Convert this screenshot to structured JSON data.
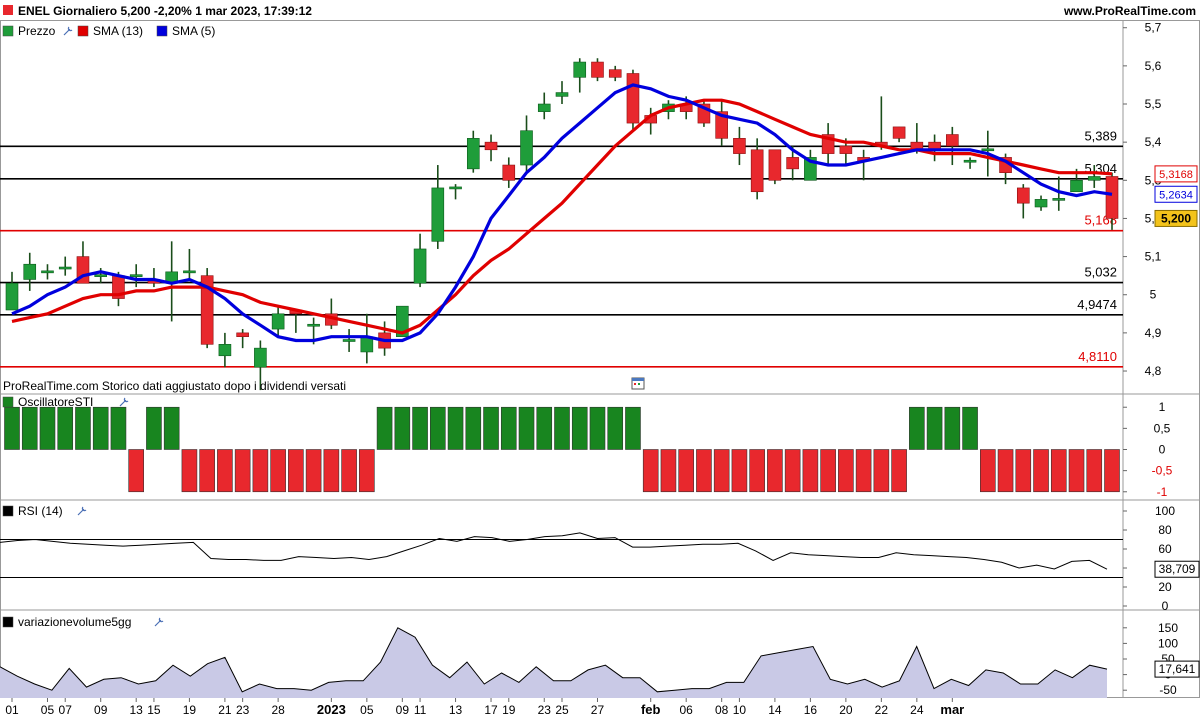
{
  "header": {
    "title": "ENEL Giornaliero 5,200 -2,20% 1 mar 2023, 17:39:12",
    "brand": "www.ProRealTime.com"
  },
  "footnote": "ProRealTime.com Storico dati aggiustato dopo i dividendi versati",
  "colors": {
    "up": "#1f9d3a",
    "down": "#e8282d",
    "sma13": "#e00000",
    "sma5": "#0000dd",
    "volume_fill": "#c9c9e6"
  },
  "chart_data": [
    {
      "type": "candlestick",
      "legend": [
        "Prezzo",
        "SMA (13)",
        "SMA (5)"
      ],
      "ylim": [
        4.745,
        5.715
      ],
      "y_ticks": [
        "5,7",
        "5,6",
        "5,5",
        "5,4",
        "5,3",
        "5,2",
        "5,1",
        "5",
        "4,9",
        "4,8"
      ],
      "x_ticks": [
        "01",
        "05",
        "07",
        "09",
        "13",
        "15",
        "19",
        "21",
        "23",
        "28",
        "2023",
        "05",
        "09",
        "11",
        "13",
        "17",
        "19",
        "23",
        "25",
        "27",
        "feb",
        "06",
        "08",
        "10",
        "14",
        "16",
        "20",
        "22",
        "24",
        "mar"
      ],
      "x_tick_index": [
        0,
        2,
        3,
        5,
        7,
        8,
        10,
        12,
        13,
        15,
        18,
        20,
        22,
        23,
        25,
        27,
        28,
        30,
        31,
        33,
        36,
        38,
        40,
        41,
        43,
        45,
        47,
        49,
        51,
        53
      ],
      "ohlc": [
        [
          4.96,
          5.03,
          4.98,
          5.06
        ],
        [
          5.04,
          5.08,
          5.01,
          5.11
        ],
        [
          5.06,
          5.06,
          5.04,
          5.08
        ],
        [
          5.07,
          5.07,
          5.05,
          5.1
        ],
        [
          5.1,
          5.03,
          5.03,
          5.14
        ],
        [
          5.05,
          5.05,
          5.03,
          5.07
        ],
        [
          5.05,
          4.99,
          4.97,
          5.06
        ],
        [
          5.05,
          5.05,
          5.02,
          5.08
        ],
        [
          5.04,
          5.03,
          5.02,
          5.07
        ],
        [
          5.03,
          5.06,
          4.93,
          5.14
        ],
        [
          5.06,
          5.06,
          5.04,
          5.12
        ],
        [
          5.05,
          4.87,
          4.86,
          5.07
        ],
        [
          4.84,
          4.87,
          4.81,
          4.9
        ],
        [
          4.9,
          4.89,
          4.86,
          4.91
        ],
        [
          4.81,
          4.86,
          4.75,
          4.88
        ],
        [
          4.91,
          4.95,
          4.89,
          4.97
        ],
        [
          4.96,
          4.95,
          4.9,
          4.96
        ],
        [
          4.92,
          4.92,
          4.87,
          4.94
        ],
        [
          4.95,
          4.92,
          4.91,
          4.99
        ],
        [
          4.88,
          4.88,
          4.85,
          4.91
        ],
        [
          4.85,
          4.89,
          4.82,
          4.95
        ],
        [
          4.9,
          4.86,
          4.84,
          4.93
        ],
        [
          4.89,
          4.97,
          4.89,
          4.97
        ],
        [
          5.03,
          5.12,
          5.02,
          5.16
        ],
        [
          5.14,
          5.28,
          5.12,
          5.34
        ],
        [
          5.28,
          5.28,
          5.25,
          5.29
        ],
        [
          5.33,
          5.41,
          5.32,
          5.43
        ],
        [
          5.4,
          5.38,
          5.35,
          5.42
        ],
        [
          5.34,
          5.3,
          5.28,
          5.36
        ],
        [
          5.34,
          5.43,
          5.32,
          5.47
        ],
        [
          5.48,
          5.5,
          5.46,
          5.53
        ],
        [
          5.52,
          5.53,
          5.5,
          5.56
        ],
        [
          5.57,
          5.61,
          5.53,
          5.62
        ],
        [
          5.61,
          5.57,
          5.56,
          5.62
        ],
        [
          5.59,
          5.57,
          5.56,
          5.6
        ],
        [
          5.58,
          5.45,
          5.43,
          5.59
        ],
        [
          5.47,
          5.45,
          5.42,
          5.49
        ],
        [
          5.48,
          5.5,
          5.46,
          5.51
        ],
        [
          5.5,
          5.48,
          5.46,
          5.52
        ],
        [
          5.5,
          5.45,
          5.44,
          5.51
        ],
        [
          5.48,
          5.41,
          5.39,
          5.51
        ],
        [
          5.41,
          5.37,
          5.34,
          5.44
        ],
        [
          5.38,
          5.27,
          5.25,
          5.41
        ],
        [
          5.38,
          5.3,
          5.29,
          5.38
        ],
        [
          5.36,
          5.33,
          5.3,
          5.39
        ],
        [
          5.3,
          5.36,
          5.3,
          5.38
        ],
        [
          5.42,
          5.37,
          5.34,
          5.45
        ],
        [
          5.39,
          5.37,
          5.34,
          5.41
        ],
        [
          5.36,
          5.35,
          5.3,
          5.38
        ],
        [
          5.4,
          5.39,
          5.38,
          5.52
        ],
        [
          5.44,
          5.41,
          5.4,
          5.44
        ],
        [
          5.4,
          5.38,
          5.37,
          5.45
        ],
        [
          5.4,
          5.38,
          5.35,
          5.42
        ],
        [
          5.42,
          5.39,
          5.34,
          5.44
        ],
        [
          5.35,
          5.35,
          5.33,
          5.36
        ],
        [
          5.38,
          5.38,
          5.31,
          5.43
        ],
        [
          5.36,
          5.32,
          5.29,
          5.37
        ],
        [
          5.28,
          5.24,
          5.2,
          5.29
        ],
        [
          5.23,
          5.25,
          5.22,
          5.26
        ],
        [
          5.25,
          5.25,
          5.22,
          5.31
        ],
        [
          5.27,
          5.3,
          5.27,
          5.33
        ],
        [
          5.3,
          5.31,
          5.28,
          5.34
        ],
        [
          5.31,
          5.2,
          5.17,
          5.32
        ]
      ],
      "sma13": [
        4.93,
        4.94,
        4.95,
        4.97,
        4.99,
        5.0,
        5.0,
        5.01,
        5.01,
        5.02,
        5.02,
        5.02,
        5.01,
        5.0,
        4.98,
        4.97,
        4.96,
        4.95,
        4.94,
        4.93,
        4.92,
        4.91,
        4.9,
        4.92,
        4.96,
        5.0,
        5.05,
        5.09,
        5.12,
        5.16,
        5.2,
        5.24,
        5.29,
        5.34,
        5.39,
        5.43,
        5.47,
        5.49,
        5.5,
        5.51,
        5.51,
        5.5,
        5.48,
        5.46,
        5.44,
        5.42,
        5.41,
        5.4,
        5.4,
        5.39,
        5.38,
        5.38,
        5.37,
        5.37,
        5.37,
        5.36,
        5.35,
        5.34,
        5.33,
        5.32,
        5.32,
        5.32,
        5.3168
      ],
      "sma5": [
        4.95,
        4.97,
        5.0,
        5.02,
        5.05,
        5.06,
        5.05,
        5.04,
        5.04,
        5.03,
        5.04,
        5.02,
        4.99,
        4.95,
        4.92,
        4.89,
        4.88,
        4.88,
        4.89,
        4.89,
        4.89,
        4.88,
        4.88,
        4.9,
        4.95,
        5.02,
        5.1,
        5.2,
        5.26,
        5.32,
        5.36,
        5.41,
        5.45,
        5.49,
        5.53,
        5.55,
        5.54,
        5.52,
        5.51,
        5.49,
        5.47,
        5.46,
        5.45,
        5.42,
        5.38,
        5.35,
        5.34,
        5.34,
        5.35,
        5.36,
        5.37,
        5.38,
        5.38,
        5.38,
        5.38,
        5.37,
        5.35,
        5.32,
        5.29,
        5.27,
        5.26,
        5.27,
        5.2634
      ],
      "levels": [
        {
          "value": 5.389,
          "label": "5,389",
          "color": "#000000"
        },
        {
          "value": 5.304,
          "label": "5,304",
          "color": "#000000"
        },
        {
          "value": 5.168,
          "label": "5,168",
          "color": "#e00000"
        },
        {
          "value": 5.032,
          "label": "5,032",
          "color": "#000000"
        },
        {
          "value": 4.9474,
          "label": "4,9474",
          "color": "#000000"
        },
        {
          "value": 4.811,
          "label": "4,8110",
          "color": "#e00000"
        }
      ],
      "badges": [
        {
          "value": 5.3168,
          "label": "5,3168",
          "color": "#e00000"
        },
        {
          "value": 5.2634,
          "label": "5,2634",
          "color": "#0000dd"
        },
        {
          "value": 5.2,
          "label": "5,200",
          "color": "#000000"
        }
      ]
    },
    {
      "type": "bar",
      "legend": [
        "OscillatoreSTI"
      ],
      "ylim": [
        -1.1,
        1.1
      ],
      "y_ticks": [
        "1",
        "0,5",
        "0",
        "-0,5",
        "-1"
      ],
      "values": [
        1,
        1,
        1,
        1,
        1,
        1,
        1,
        -1,
        1,
        1,
        -1,
        -1,
        -1,
        -1,
        -1,
        -1,
        -1,
        -1,
        -1,
        -1,
        -1,
        1,
        1,
        1,
        1,
        1,
        1,
        1,
        1,
        1,
        1,
        1,
        1,
        1,
        1,
        1,
        -1,
        -1,
        -1,
        -1,
        -1,
        -1,
        -1,
        -1,
        -1,
        -1,
        -1,
        -1,
        -1,
        -1,
        -1,
        1,
        1,
        1,
        1,
        -1,
        -1,
        -1,
        -1,
        -1,
        -1,
        -1,
        -1
      ]
    },
    {
      "type": "line",
      "legend": [
        "RSI (14)"
      ],
      "ylim": [
        0,
        100
      ],
      "y_ticks": [
        "100",
        "80",
        "60",
        "40",
        "20",
        "0"
      ],
      "reference": [
        70,
        30
      ],
      "last_label": "38,709",
      "values": [
        67,
        69,
        70,
        68,
        66,
        65,
        64,
        63,
        64,
        65,
        66,
        67,
        50,
        49,
        49,
        48,
        48,
        52,
        51,
        50,
        51,
        49,
        52,
        58,
        64,
        71,
        68,
        73,
        72,
        68,
        70,
        73,
        74,
        77,
        71,
        72,
        62,
        62,
        63,
        64,
        65,
        65,
        66,
        58,
        48,
        56,
        54,
        53,
        52,
        51,
        51,
        56,
        54,
        53,
        52,
        51,
        49,
        46,
        40,
        43,
        39,
        47,
        48,
        38.7
      ]
    },
    {
      "type": "area",
      "legend": [
        "variazionevolume5gg"
      ],
      "ylim": [
        -75,
        175
      ],
      "y_ticks": [
        "150",
        "100",
        "50",
        "0",
        "-50"
      ],
      "last_label": "17,641",
      "values": [
        25,
        -5,
        -30,
        -50,
        20,
        -40,
        -15,
        -10,
        -30,
        -20,
        30,
        -5,
        35,
        55,
        -55,
        -30,
        -45,
        -45,
        -50,
        -25,
        -20,
        -20,
        40,
        150,
        120,
        30,
        -10,
        40,
        -30,
        5,
        -25,
        25,
        -20,
        -20,
        15,
        30,
        -10,
        -10,
        -55,
        -50,
        -45,
        -45,
        -25,
        -25,
        60,
        70,
        80,
        90,
        -15,
        -30,
        -15,
        -40,
        -20,
        90,
        -45,
        -15,
        -35,
        15,
        5,
        -30,
        -30,
        15,
        -10,
        30,
        17.6
      ]
    }
  ]
}
